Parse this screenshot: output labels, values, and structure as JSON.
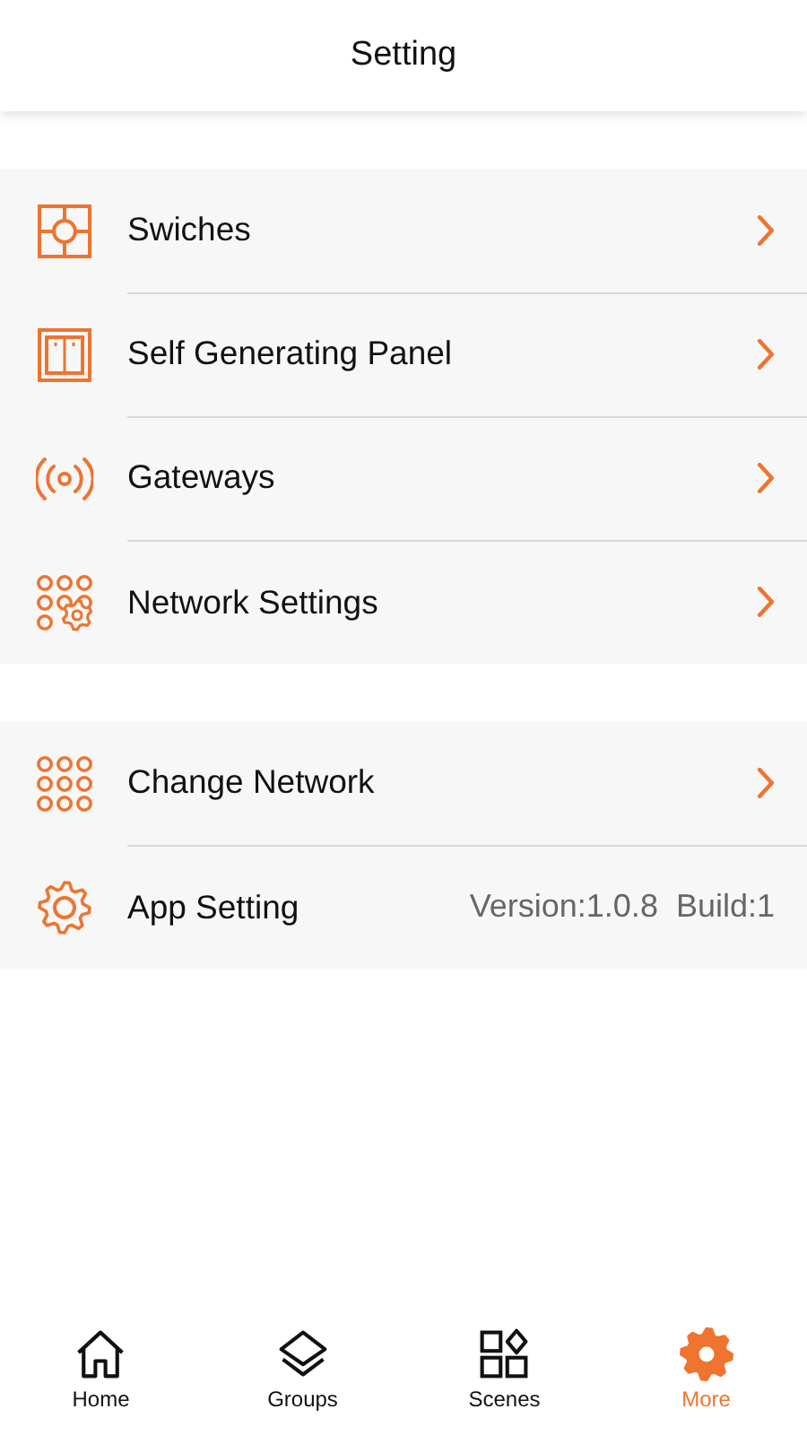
{
  "header": {
    "title": "Setting"
  },
  "sections": [
    {
      "items": [
        {
          "kind": "switch",
          "label": "Swiches",
          "chevron": true
        },
        {
          "kind": "panel",
          "label": "Self Generating Panel",
          "chevron": true
        },
        {
          "kind": "gateway",
          "label": "Gateways",
          "chevron": true
        },
        {
          "kind": "network-settings",
          "label": "Network Settings",
          "chevron": true
        }
      ]
    },
    {
      "items": [
        {
          "kind": "change-network",
          "label": "Change Network",
          "chevron": true
        },
        {
          "kind": "app-setting",
          "label": "App Setting",
          "chevron": false,
          "detail": "Version:1.0.8  Build:1"
        }
      ]
    }
  ],
  "tab_bar": [
    {
      "kind": "home",
      "label": "Home",
      "selected": false
    },
    {
      "kind": "groups",
      "label": "Groups",
      "selected": false
    },
    {
      "kind": "scenes",
      "label": "Scenes",
      "selected": false
    },
    {
      "kind": "more",
      "label": "More",
      "selected": true
    }
  ]
}
